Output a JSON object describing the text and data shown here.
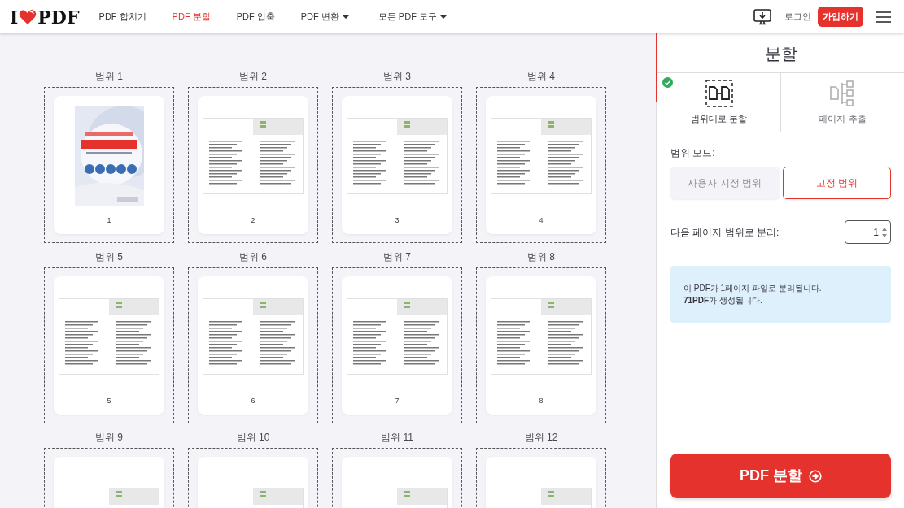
{
  "nav": {
    "logo": {
      "left": "I",
      "right": "PDF"
    },
    "links": [
      {
        "label": "PDF 합치기",
        "selected": false,
        "dropdown": false
      },
      {
        "label": "PDF 분할",
        "selected": true,
        "dropdown": false
      },
      {
        "label": "PDF 압축",
        "selected": false,
        "dropdown": false
      },
      {
        "label": "PDF 변환",
        "selected": false,
        "dropdown": true
      },
      {
        "label": "모든 PDF 도구",
        "selected": false,
        "dropdown": true
      }
    ],
    "login": "로그인",
    "signup": "가입하기"
  },
  "ranges": [
    {
      "label": "범위 1",
      "page": "1",
      "kind": "cover"
    },
    {
      "label": "범위 2",
      "page": "2",
      "kind": "spread"
    },
    {
      "label": "범위 3",
      "page": "3",
      "kind": "spread"
    },
    {
      "label": "범위 4",
      "page": "4",
      "kind": "spread"
    },
    {
      "label": "범위 5",
      "page": "5",
      "kind": "spread"
    },
    {
      "label": "범위 6",
      "page": "6",
      "kind": "spread"
    },
    {
      "label": "범위 7",
      "page": "7",
      "kind": "spread"
    },
    {
      "label": "범위 8",
      "page": "8",
      "kind": "spread"
    },
    {
      "label": "범위 9",
      "kind": "spread"
    },
    {
      "label": "범위 10",
      "kind": "spread"
    },
    {
      "label": "범위 11",
      "kind": "spread"
    },
    {
      "label": "범위 12",
      "kind": "spread"
    }
  ],
  "panel": {
    "title": "분할",
    "tabs": [
      {
        "label": "범위대로 분할",
        "selected": true,
        "kind": "ranges"
      },
      {
        "label": "페이지 추출",
        "selected": false,
        "kind": "extract"
      }
    ],
    "mode_label": "범위 모드:",
    "modes": [
      {
        "label": "사용자 지정 범위",
        "selected": false
      },
      {
        "label": "고정 범위",
        "selected": true
      }
    ],
    "split_label": "다음 페이지 범위로 분리:",
    "split_value": "1",
    "info": [
      "이 PDF가 1페이지 파일로 분리됩니다.",
      "**71PDF**가 생성됩니다."
    ],
    "submit": "PDF 분할"
  }
}
